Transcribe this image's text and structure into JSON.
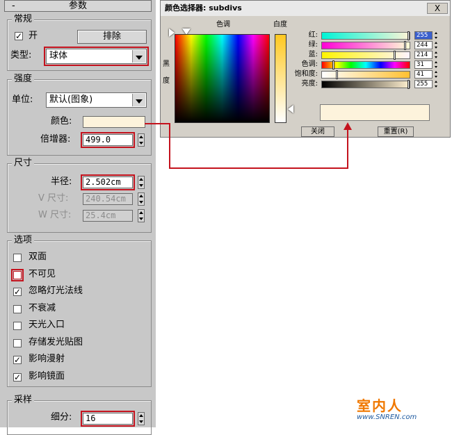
{
  "panel": {
    "rollout_title": "参数",
    "rollout_toggle": "-",
    "general": {
      "title": "常规",
      "on_label": "开",
      "on_checked": true,
      "exclude_label": "排除",
      "type_label": "类型:",
      "type_value": "球体"
    },
    "intensity": {
      "title": "强度",
      "units_label": "单位:",
      "units_value": "默认(图象)",
      "color_label": "颜色:",
      "color_swatch": "#fdf3dc",
      "multiplier_label": "倍增器:",
      "multiplier_value": "499.0"
    },
    "size": {
      "title": "尺寸",
      "radius_label": "半径:",
      "radius_value": "2.502cm",
      "v_label": "V 尺寸:",
      "v_value": "240.54cm",
      "w_label": "W 尺寸:",
      "w_value": "25.4cm"
    },
    "options": {
      "title": "选项",
      "items": [
        {
          "label": "双面",
          "checked": false
        },
        {
          "label": "不可见",
          "checked": false
        },
        {
          "label": "忽略灯光法线",
          "checked": true
        },
        {
          "label": "不衰减",
          "checked": false
        },
        {
          "label": "天光入口",
          "checked": false
        },
        {
          "label": "存储发光贴图",
          "checked": false
        },
        {
          "label": "影响漫射",
          "checked": true
        },
        {
          "label": "影响镜面",
          "checked": true
        }
      ]
    },
    "sampling": {
      "title": "采样",
      "subdivs_label": "细分:",
      "subdivs_value": "16"
    }
  },
  "dialog": {
    "title": "颜色选择器: subdivs",
    "close_x": "X",
    "hue_label": "色调",
    "whiteness_label": "白度",
    "blackness_label": "黑度",
    "sliders": [
      {
        "label": "红:",
        "value": "255",
        "level": 1.0
      },
      {
        "label": "绿:",
        "value": "244",
        "level": 0.957
      },
      {
        "label": "蓝:",
        "value": "214",
        "level": 0.839
      },
      {
        "label": "色调:",
        "value": "31",
        "level": 0.12
      },
      {
        "label": "饱和度:",
        "value": "41",
        "level": 0.16
      },
      {
        "label": "亮度:",
        "value": "255",
        "level": 1.0
      }
    ],
    "close_button": "关闭",
    "reset_button": "重置(R)",
    "preview_color": "#fdf3dc"
  },
  "annotation_color": "#c4121d",
  "watermark": {
    "name": "室内人",
    "url": "www.SNREN.com"
  }
}
